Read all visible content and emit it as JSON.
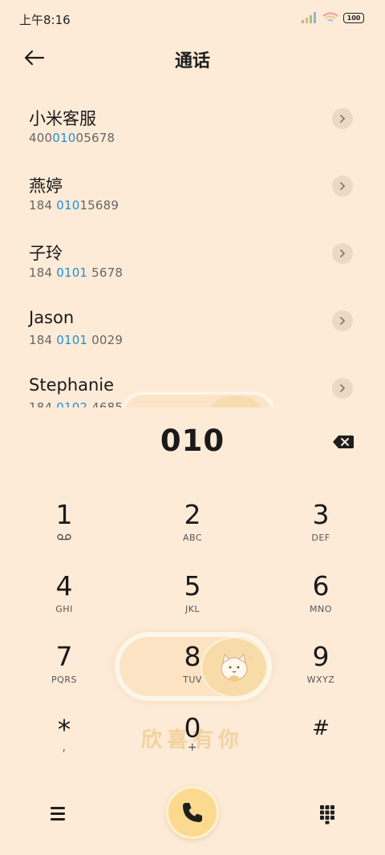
{
  "status": {
    "time": "上午8:16",
    "battery": "100"
  },
  "header": {
    "title": "通话"
  },
  "contacts": [
    {
      "name": "小米客服",
      "number_pre": "400",
      "number_match": "010",
      "number_post": "05678"
    },
    {
      "name": "燕婷",
      "number_pre": "184 ",
      "number_match": "010",
      "number_post": "15689"
    },
    {
      "name": "子玲",
      "number_pre": "184 ",
      "number_match": "0101",
      "number_post": " 5678"
    },
    {
      "name": "Jason",
      "number_pre": "184 ",
      "number_match": "0101",
      "number_post": " 0029"
    },
    {
      "name": "Stephanie",
      "number_pre": "184 ",
      "number_match": "0102",
      "number_post": " 4685"
    }
  ],
  "dialer": {
    "digits": "010",
    "keys": [
      {
        "num": "1",
        "sub": "voicemail"
      },
      {
        "num": "2",
        "sub": "ABC"
      },
      {
        "num": "3",
        "sub": "DEF"
      },
      {
        "num": "4",
        "sub": "GHI"
      },
      {
        "num": "5",
        "sub": "JKL"
      },
      {
        "num": "6",
        "sub": "MNO"
      },
      {
        "num": "7",
        "sub": "PQRS"
      },
      {
        "num": "8",
        "sub": "TUV"
      },
      {
        "num": "9",
        "sub": "WXYZ"
      },
      {
        "num": "*",
        "sub": ","
      },
      {
        "num": "0",
        "sub": "+"
      },
      {
        "num": "#",
        "sub": ""
      }
    ]
  },
  "theme": {
    "watermark": "欣喜有你",
    "accent": "#1f8fd6",
    "call_button": "#fbd98f",
    "background": "#fdebd7"
  }
}
